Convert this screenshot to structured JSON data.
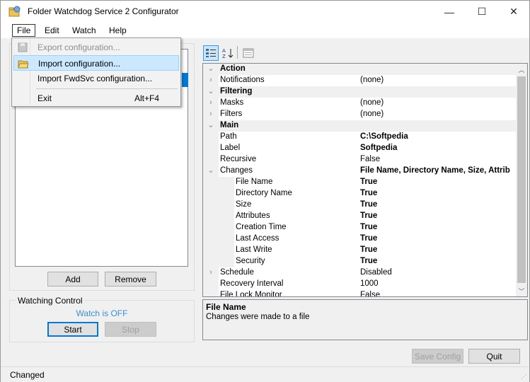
{
  "window": {
    "title": "Folder Watchdog Service 2 Configurator",
    "minimize_glyph": "—",
    "maximize_glyph": "☐",
    "close_glyph": "✕"
  },
  "menu": {
    "file": "File",
    "edit": "Edit",
    "watch": "Watch",
    "help": "Help"
  },
  "file_menu": {
    "export": "Export configuration...",
    "import": "Import configuration...",
    "import_fwd": "Import FwdSvc configuration...",
    "exit": "Exit",
    "exit_shortcut": "Alt+F4"
  },
  "left": {
    "add_label": "Add",
    "remove_label": "Remove",
    "watching_title": "Watching Control",
    "watch_status": "Watch is OFF",
    "start_label": "Start",
    "stop_label": "Stop"
  },
  "toolbar": {
    "categorized_icon": "categorized-icon",
    "alphabetical_icon": "alphabetical-icon",
    "pages_icon": "property-pages-icon"
  },
  "properties": [
    {
      "type": "category",
      "expander": "⌄",
      "name": "Action"
    },
    {
      "type": "prop",
      "expander": "›",
      "name": "Notifications",
      "value": "(none)",
      "bold": false
    },
    {
      "type": "category",
      "expander": "⌄",
      "name": "Filtering"
    },
    {
      "type": "prop",
      "expander": "›",
      "name": "Masks",
      "value": "(none)",
      "bold": false
    },
    {
      "type": "prop",
      "expander": "›",
      "name": "Filters",
      "value": "(none)",
      "bold": false
    },
    {
      "type": "category",
      "expander": "⌄",
      "name": "Main"
    },
    {
      "type": "prop",
      "expander": "",
      "name": "Path",
      "value": "C:\\Softpedia",
      "bold": true
    },
    {
      "type": "prop",
      "expander": "",
      "name": "Label",
      "value": "Softpedia",
      "bold": true
    },
    {
      "type": "prop",
      "expander": "",
      "name": "Recursive",
      "value": "False",
      "bold": false
    },
    {
      "type": "prop",
      "expander": "⌄",
      "name": "Changes",
      "value": "File Name, Directory Name, Size, Attrib",
      "bold": true
    },
    {
      "type": "sub",
      "expander": "",
      "name": "File Name",
      "value": "True",
      "bold": true
    },
    {
      "type": "sub",
      "expander": "",
      "name": "Directory Name",
      "value": "True",
      "bold": true
    },
    {
      "type": "sub",
      "expander": "",
      "name": "Size",
      "value": "True",
      "bold": true
    },
    {
      "type": "sub",
      "expander": "",
      "name": "Attributes",
      "value": "True",
      "bold": true
    },
    {
      "type": "sub",
      "expander": "",
      "name": "Creation Time",
      "value": "True",
      "bold": true
    },
    {
      "type": "sub",
      "expander": "",
      "name": "Last Access",
      "value": "True",
      "bold": true
    },
    {
      "type": "sub",
      "expander": "",
      "name": "Last Write",
      "value": "True",
      "bold": true
    },
    {
      "type": "sub",
      "expander": "",
      "name": "Security",
      "value": "True",
      "bold": true
    },
    {
      "type": "prop",
      "expander": "›",
      "name": "Schedule",
      "value": "Disabled",
      "bold": false
    },
    {
      "type": "prop",
      "expander": "",
      "name": "Recovery Interval",
      "value": "1000",
      "bold": false
    },
    {
      "type": "prop",
      "expander": "",
      "name": "File Lock Monitor",
      "value": "False",
      "bold": false
    }
  ],
  "help": {
    "title": "File Name",
    "description": "Changes were made to a file"
  },
  "bottom": {
    "save_label": "Save Config",
    "quit_label": "Quit"
  },
  "status": {
    "text": "Changed"
  }
}
